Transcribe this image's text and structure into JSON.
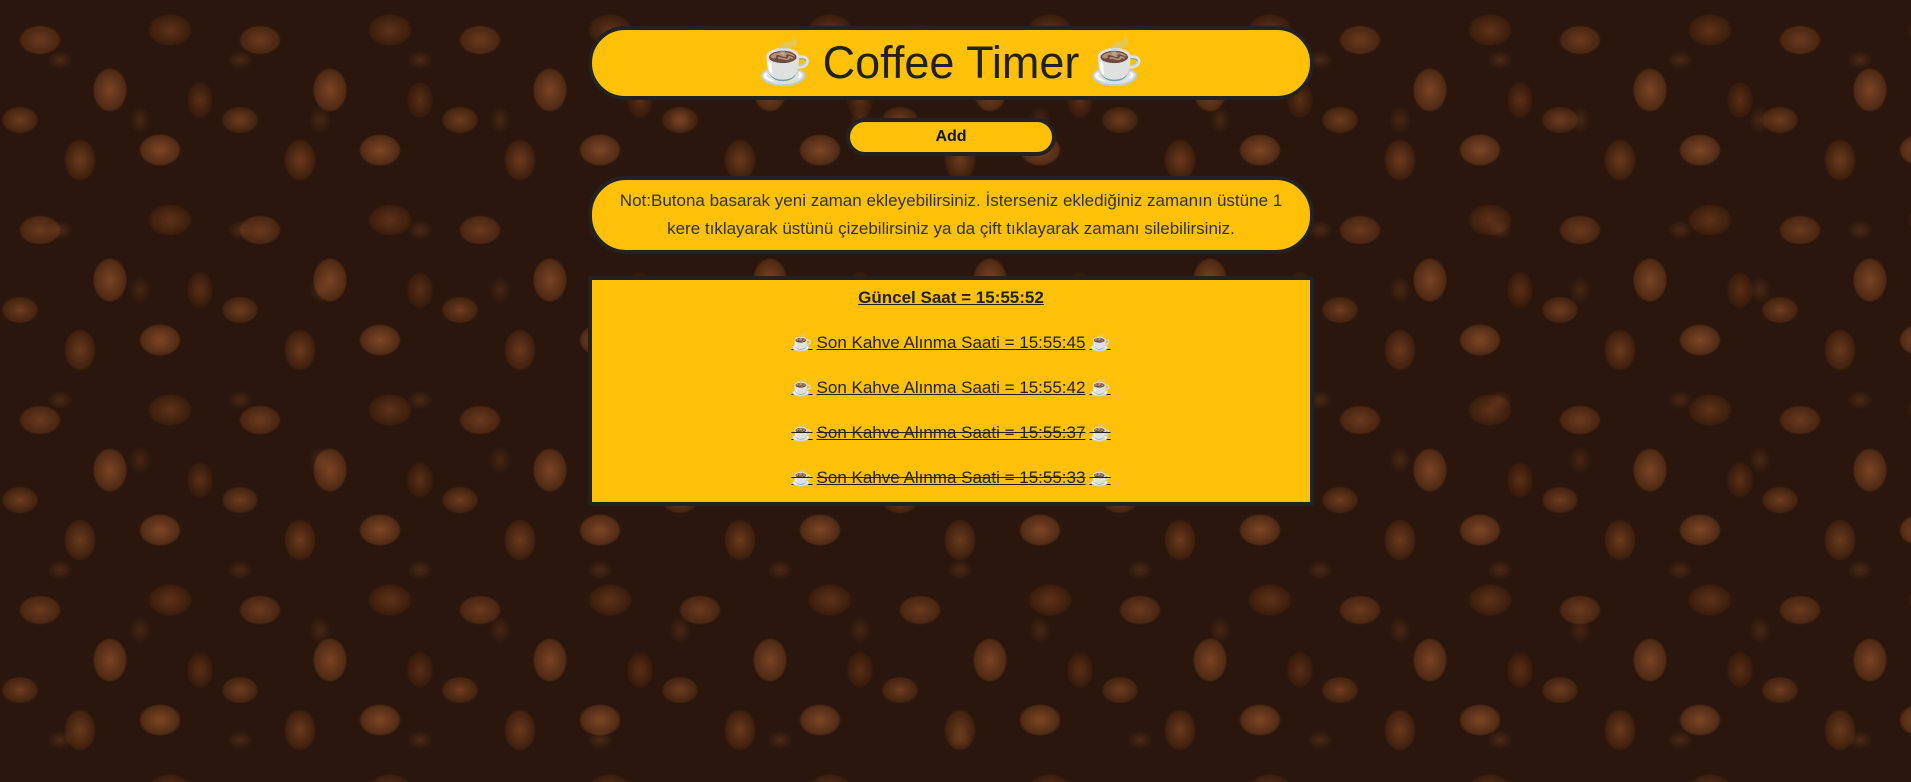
{
  "header": {
    "title": "Coffee Timer",
    "cup_left": "☕",
    "cup_right": "☕"
  },
  "toolbar": {
    "add_label": "Add"
  },
  "note": {
    "text": "Not:Butona basarak yeni zaman ekleyebilirsiniz. İsterseniz eklediğiniz zamanın üstüne 1 kere tıklayarak üstünü çizebilirsiniz ya da çift tıklayarak zamanı silebilirsiniz."
  },
  "clock": {
    "current_label": "Güncel Saat = 15:55:52"
  },
  "entries": [
    {
      "label": "Son Kahve Alınma Saati = 15:55:45",
      "crossed": false,
      "cup": "☕"
    },
    {
      "label": "Son Kahve Alınma Saati = 15:55:42",
      "crossed": false,
      "cup": "☕"
    },
    {
      "label": "Son Kahve Alınma Saati = 15:55:37",
      "crossed": true,
      "cup": "☕"
    },
    {
      "label": "Son Kahve Alınma Saati = 15:55:33",
      "crossed": true,
      "cup": "☕"
    }
  ],
  "colors": {
    "accent": "#ffc107",
    "border": "#222222",
    "background": "#2a160c"
  },
  "icons": {
    "cup": "coffee-cup-icon"
  }
}
